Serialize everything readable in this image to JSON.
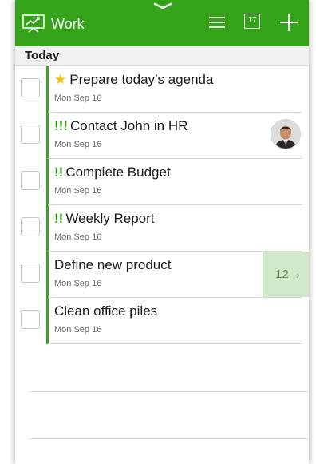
{
  "header": {
    "title": "Work",
    "calendar_day": "17",
    "accent_color": "#34a319"
  },
  "section": {
    "title": "Today"
  },
  "tasks": [
    {
      "title": "Prepare today’s agenda",
      "date": "Mon Sep 16",
      "priority": "",
      "starred": true
    },
    {
      "title": "Contact John in HR",
      "date": "Mon Sep 16",
      "priority": "!!!",
      "starred": false,
      "has_avatar": true
    },
    {
      "title": "Complete Budget",
      "date": "Mon Sep 16",
      "priority": "!!",
      "starred": false
    },
    {
      "title": "Weekly Report",
      "date": "Mon Sep 16",
      "priority": "!!",
      "starred": false
    },
    {
      "title": "Define new product",
      "date": "Mon Sep 16",
      "priority": "",
      "starred": false,
      "swipe_value": "12",
      "swipe_chevron": "›"
    },
    {
      "title": "Clean office piles",
      "date": "Mon Sep 16",
      "priority": "",
      "starred": false
    }
  ],
  "icons": {
    "app": "presentation-chart-icon",
    "menu": "menu-icon",
    "calendar": "calendar-icon",
    "add": "plus-icon",
    "pull": "chevron-down-icon",
    "star": "star-icon"
  }
}
